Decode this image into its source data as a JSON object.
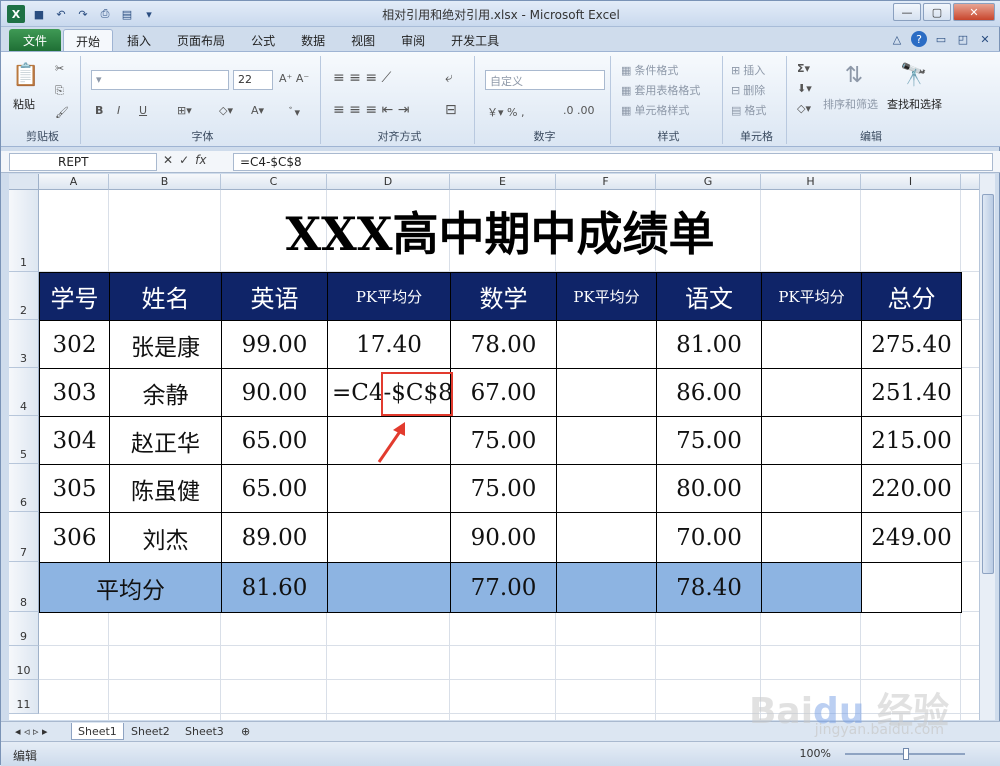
{
  "window": {
    "title": "相对引用和绝对引用.xlsx - Microsoft Excel"
  },
  "ribbon_tabs": [
    "文件",
    "开始",
    "插入",
    "页面布局",
    "公式",
    "数据",
    "视图",
    "审阅",
    "开发工具"
  ],
  "ribbon": {
    "paste": "粘贴",
    "clipboard": "剪贴板",
    "font_group": "字体",
    "font_size": "22",
    "align_group": "对齐方式",
    "number_format": "自定义",
    "number_group": "数字",
    "cond_format": "条件格式",
    "table_format": "套用表格格式",
    "cell_style": "单元格样式",
    "style_group": "样式",
    "insert": "插入",
    "delete": "删除",
    "format": "格式",
    "cells_group": "单元格",
    "sort_filter": "排序和筛选",
    "find_select": "查找和选择",
    "edit_group": "编辑"
  },
  "formula_bar": {
    "name_box": "REPT",
    "formula": "=C4-$C$8"
  },
  "columns": [
    "A",
    "B",
    "C",
    "D",
    "E",
    "F",
    "G",
    "H",
    "I"
  ],
  "rows": [
    "1",
    "2",
    "3",
    "4",
    "5",
    "6",
    "7",
    "8",
    "9",
    "10",
    "11"
  ],
  "sheet": {
    "title": "XXX高中期中成绩单",
    "headers": [
      "学号",
      "姓名",
      "英语",
      "PK平均分",
      "数学",
      "PK平均分",
      "语文",
      "PK平均分",
      "总分"
    ],
    "data_rows": [
      [
        "302",
        "张是康",
        "99.00",
        "17.40",
        "78.00",
        "",
        "81.00",
        "",
        "275.40"
      ],
      [
        "303",
        "余静",
        "90.00",
        "",
        "67.00",
        "",
        "86.00",
        "",
        "251.40"
      ],
      [
        "304",
        "赵正华",
        "65.00",
        "",
        "75.00",
        "",
        "75.00",
        "",
        "215.00"
      ],
      [
        "305",
        "陈虽健",
        "65.00",
        "",
        "75.00",
        "",
        "80.00",
        "",
        "220.00"
      ],
      [
        "306",
        "刘杰",
        "89.00",
        "",
        "90.00",
        "",
        "70.00",
        "",
        "249.00"
      ]
    ],
    "editing_prefix": "=C4-",
    "editing_ref": "$C$8",
    "avg_label": "平均分",
    "avg_values": [
      "81.60",
      "",
      "77.00",
      "",
      "78.40",
      "",
      ""
    ]
  },
  "sheet_tabs": [
    "Sheet1",
    "Sheet2",
    "Sheet3"
  ],
  "status": {
    "mode": "编辑",
    "zoom": "100%"
  },
  "colors": {
    "header_fill": "#0f2468",
    "avg_fill": "#8db4e2",
    "highlight": "#e23b2e"
  }
}
